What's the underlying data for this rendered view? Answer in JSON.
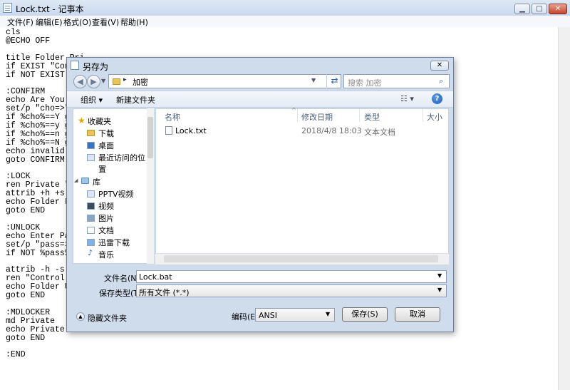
{
  "notepad": {
    "title": "Lock.txt - 记事本",
    "menu": [
      "文件(F)",
      "编辑(E)",
      "格式(O)",
      "查看(V)",
      "帮助(H)"
    ],
    "lines": [
      "cls",
      "@ECHO OFF",
      "",
      "title Folder Pri",
      "if EXIST \"Contr",
      "if NOT EXIST Pr",
      "",
      ":CONFIRM",
      "echo Are You Su",
      "set/p \"cho=>\"",
      "if %cho%==Y got",
      "if %cho%==y got",
      "if %cho%==n got",
      "if %cho%==N got",
      "echo invalid ch",
      "goto CONFIRM",
      "",
      ":LOCK",
      "ren Private \"Co",
      "attrib +h +s \"C",
      "echo Folder Loc",
      "goto END",
      "",
      ":UNLOCK",
      "echo Enter Pass",
      "set/p \"pass=>\"",
      "if NOT %pass%==",
      "",
      "attrib -h -s \"C",
      "ren \"Control Pa",
      "echo Folder Unl",
      "goto END",
      "",
      ":MDLOCKER",
      "md Private",
      "echo Private Cr",
      "goto END",
      "",
      ":END"
    ]
  },
  "dialog": {
    "title": "另存为",
    "address_segment": "加密",
    "search_placeholder": "搜索 加密",
    "toolbar": {
      "organize": "组织 ▾",
      "new_folder": "新建文件夹"
    },
    "nav": {
      "favorites": "收藏夹",
      "downloads": "下载",
      "desktop": "桌面",
      "recent": "最近访问的位置",
      "library": "库",
      "pptv": "PPTV视频",
      "video": "视频",
      "pictures": "图片",
      "docs": "文档",
      "thunder": "迅雷下载",
      "music": "音乐"
    },
    "columns": {
      "name": "名称",
      "date": "修改日期",
      "type": "类型",
      "size": "大小"
    },
    "file": {
      "name": "Lock.txt",
      "date": "2018/4/8 18:03",
      "type": "文本文档"
    },
    "filename_label": "文件名(N):",
    "filename_value": "Lock.bat",
    "type_label": "保存类型(T):",
    "type_value": "所有文件 (*.*)",
    "hide_folders": "隐藏文件夹",
    "encoding_label": "编码(E):",
    "encoding_value": "ANSI",
    "save_button": "保存(S)",
    "cancel_button": "取消"
  }
}
